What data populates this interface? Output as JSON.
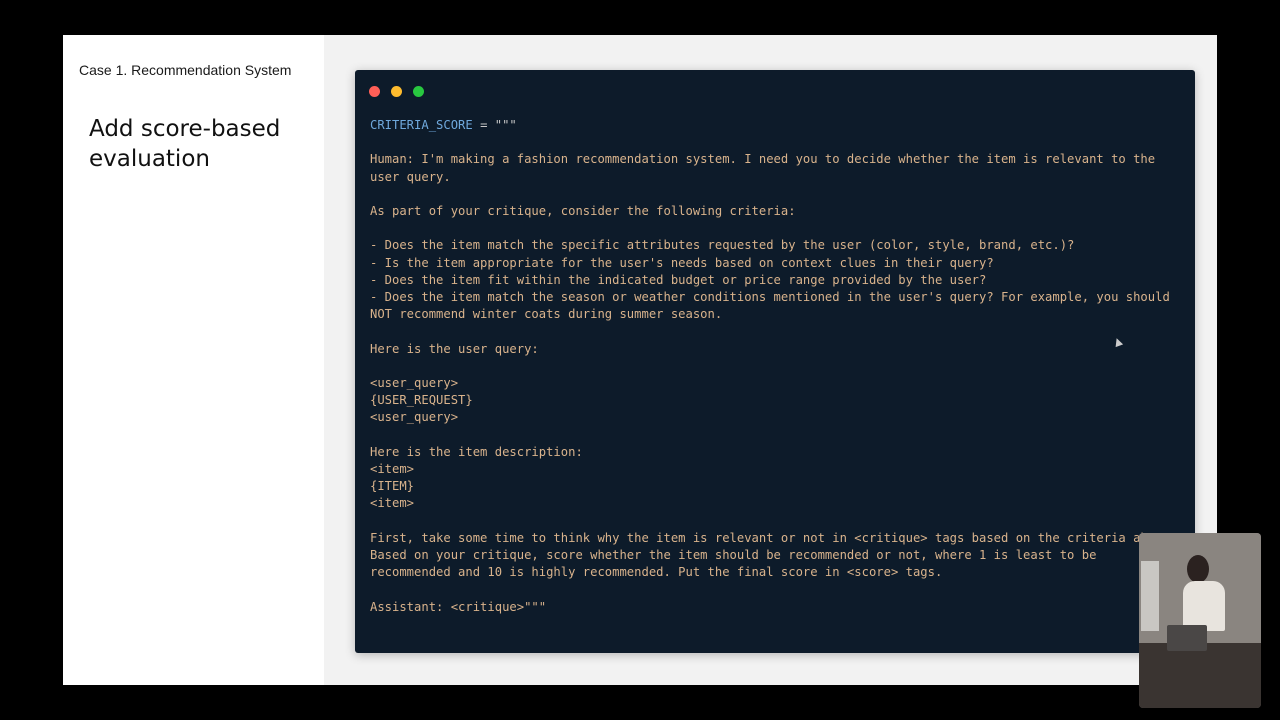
{
  "slide": {
    "case_label": "Case 1. Recommendation System",
    "title": "Add score-based evaluation"
  },
  "terminal": {
    "dot_colors": [
      "#ff5f57",
      "#febc2e",
      "#28c840"
    ],
    "code": {
      "var_name": "CRITERIA_SCORE",
      "assign": " = ",
      "open_quotes": "\"\"\"",
      "body": "\n\nHuman: I'm making a fashion recommendation system. I need you to decide whether the item is relevant to the user query.\n\nAs part of your critique, consider the following criteria:\n\n- Does the item match the specific attributes requested by the user (color, style, brand, etc.)?\n- Is the item appropriate for the user's needs based on context clues in their query?\n- Does the item fit within the indicated budget or price range provided by the user?\n- Does the item match the season or weather conditions mentioned in the user's query? For example, you should NOT recommend winter coats during summer season.\n\nHere is the user query:\n\n<user_query>\n{USER_REQUEST}\n<user_query>\n\nHere is the item description:\n<item>\n{ITEM}\n<item>\n\nFirst, take some time to think why the item is relevant or not in <critique> tags based on the criteria above.\nBased on your critique, score whether the item should be recommended or not, where 1 is least to be recommended and 10 is highly recommended. Put the final score in <score> tags.\n\nAssistant: <critique>\"\"\""
    }
  },
  "colors": {
    "terminal_bg": "#0d1b2a",
    "code_text": "#d9b38c",
    "variable": "#6fa8dc"
  }
}
